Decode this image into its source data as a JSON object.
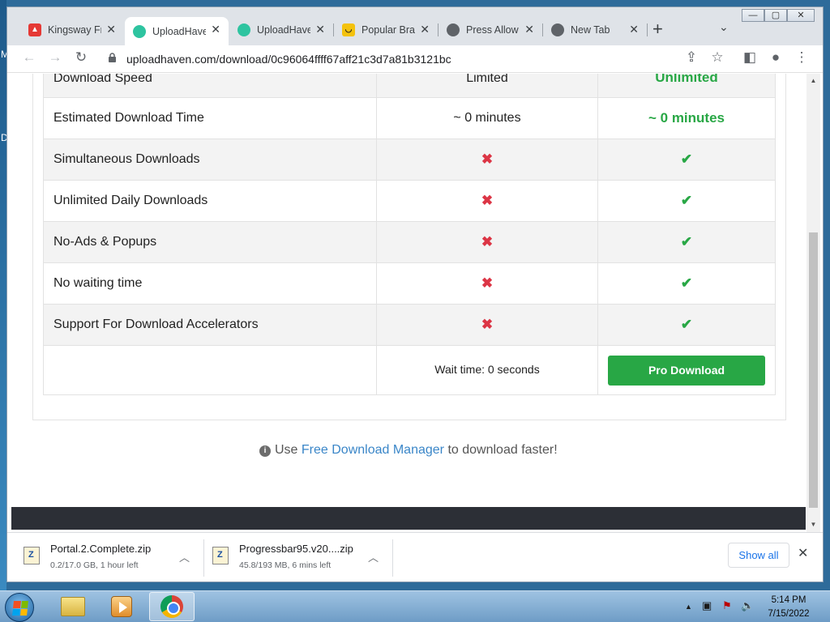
{
  "desktop": {
    "glyph_top": "M",
    "glyph_mid": "D"
  },
  "tabs": [
    {
      "label": "Kingsway Fr",
      "favicon": "fire-icon",
      "color": "#e53935"
    },
    {
      "label": "UploadHave",
      "favicon": "cloud-icon",
      "color": "#2ec4a0"
    },
    {
      "label": "UploadHave",
      "favicon": "cloud-icon",
      "color": "#2ec4a0"
    },
    {
      "label": "Popular Bra",
      "favicon": "smile-icon",
      "color": "#f4c20d"
    },
    {
      "label": "Press Allow",
      "favicon": "globe-icon",
      "color": "#5f6368"
    },
    {
      "label": "New Tab",
      "favicon": "chrome-icon",
      "color": "#5f6368"
    }
  ],
  "address": {
    "url": "uploadhaven.com/download/0c96064ffff67aff21c3d7a81b3121bc"
  },
  "comparison": {
    "rows": [
      {
        "feature": "Download Speed",
        "free": "Limited",
        "pro": "Unlimited"
      },
      {
        "feature": "Estimated Download Time",
        "free": "~ 0 minutes",
        "pro": "~ 0 minutes"
      },
      {
        "feature": "Simultaneous Downloads",
        "free": "x",
        "pro": "check"
      },
      {
        "feature": "Unlimited Daily Downloads",
        "free": "x",
        "pro": "check"
      },
      {
        "feature": "No-Ads & Popups",
        "free": "x",
        "pro": "check"
      },
      {
        "feature": "No waiting time",
        "free": "x",
        "pro": "check"
      },
      {
        "feature": "Support For Download Accelerators",
        "free": "x",
        "pro": "check"
      }
    ],
    "wait_text": "Wait time: 0 seconds",
    "pro_button": "Pro Download",
    "x_glyph": "✖",
    "check_glyph": "✔"
  },
  "promo": {
    "prefix": "Use",
    "link": "Free Download Manager",
    "suffix": "to download faster!"
  },
  "downloads": [
    {
      "name": "Portal.2.Complete.zip",
      "meta": "0.2/17.0 GB, 1 hour left"
    },
    {
      "name": "Progressbar95.v20....zip",
      "meta": "45.8/193 MB, 6 mins left"
    }
  ],
  "shelf": {
    "show_all": "Show all"
  },
  "taskbar": {
    "time": "5:14 PM",
    "date": "7/15/2022"
  },
  "colors": {
    "pro_green": "#28a745",
    "free_red": "#dc3545",
    "link_blue": "#3a86c8"
  }
}
